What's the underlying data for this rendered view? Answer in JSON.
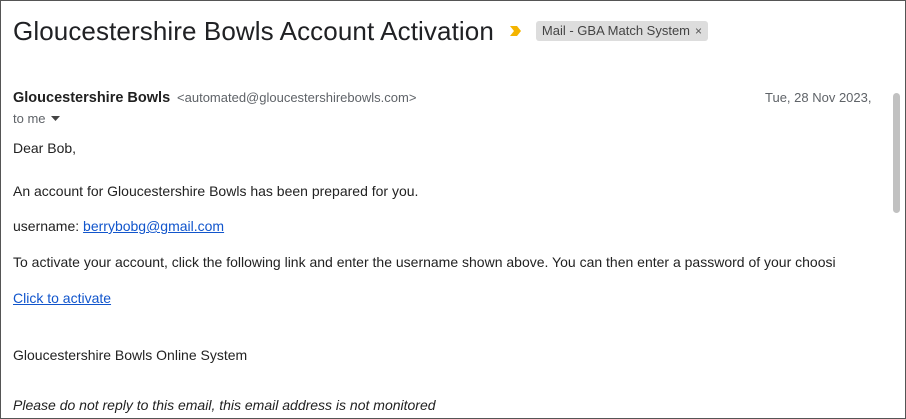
{
  "email": {
    "subject": "Gloucestershire Bowls Account Activation",
    "label": "Mail - GBA Match System",
    "label_close": "×",
    "sender_name": "Gloucestershire Bowls",
    "sender_email": "<automated@gloucestershirebowls.com>",
    "date": "Tue, 28 Nov 2023,",
    "to": "to me"
  },
  "body": {
    "greeting": "Dear Bob,",
    "line1": "An account for Gloucestershire Bowls has been prepared for you.",
    "username_prefix": "username: ",
    "username": "berrybobg@gmail.com",
    "line3": "To activate your account, click the following link and enter the username shown above. You can then enter a password of your choosi",
    "activate_link": "Click to activate",
    "signature": "Gloucestershire Bowls Online System",
    "footer": "Please do not reply to this email, this email address is not monitored"
  },
  "colors": {
    "importance": "#f4b400",
    "link": "#1155cc",
    "chip": "#dddddd"
  },
  "icons": {
    "importance": "importance-marker-icon",
    "caret": "caret-down-icon",
    "close": "close-icon"
  }
}
